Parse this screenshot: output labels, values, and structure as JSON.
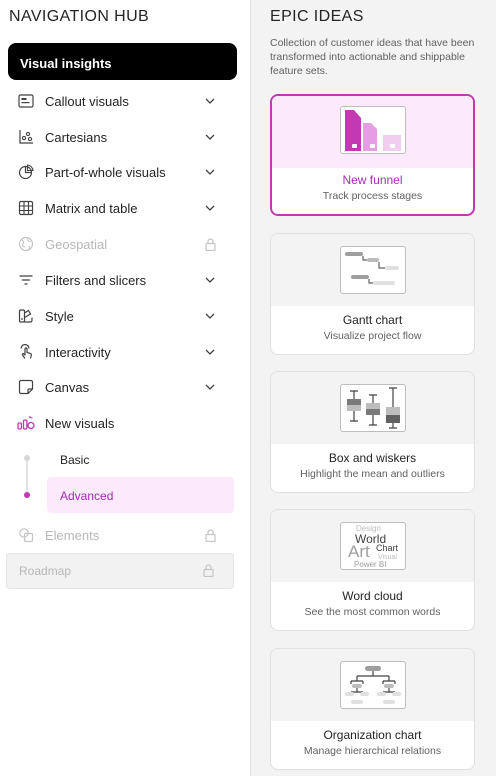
{
  "nav": {
    "title": "NAVIGATION HUB",
    "active_item": "Visual insights",
    "items": [
      {
        "label": "Callout visuals",
        "icon": "callout-icon"
      },
      {
        "label": "Cartesians",
        "icon": "cartesian-icon"
      },
      {
        "label": "Part-of-whole visuals",
        "icon": "pie-icon"
      },
      {
        "label": "Matrix and table",
        "icon": "table-icon"
      },
      {
        "label": "Geospatial",
        "icon": "globe-icon",
        "disabled": true
      },
      {
        "label": "Filters and slicers",
        "icon": "filter-icon"
      },
      {
        "label": "Style",
        "icon": "style-icon"
      },
      {
        "label": "Interactivity",
        "icon": "interactivity-icon"
      },
      {
        "label": "Canvas",
        "icon": "canvas-icon"
      },
      {
        "label": "New visuals",
        "icon": "new-visuals-icon",
        "expanded": true
      }
    ],
    "sub_items": [
      {
        "label": "Basic"
      },
      {
        "label": "Advanced",
        "selected": true
      }
    ],
    "elements": {
      "label": "Elements",
      "disabled": true
    },
    "roadmap": {
      "label": "Roadmap",
      "disabled": true
    }
  },
  "panel": {
    "title": "EPIC IDEAS",
    "description": "Collection of customer ideas that have been transformed into actionable and shippable feature sets.",
    "cards": [
      {
        "title": "New funnel",
        "subtitle": "Track process stages",
        "selected": true
      },
      {
        "title": "Gantt chart",
        "subtitle": "Visualize project flow"
      },
      {
        "title": "Box and wiskers",
        "subtitle": "Highlight the mean and outliers"
      },
      {
        "title": "Word cloud",
        "subtitle": "See the most common words",
        "words": [
          "Design",
          "World",
          "Chart",
          "Art",
          "Visual",
          "Power BI"
        ]
      },
      {
        "title": "Organization chart",
        "subtitle": "Manage hierarchical relations"
      }
    ]
  },
  "colors": {
    "accent": "#c239b3",
    "accent_text": "#a62bb6",
    "selected_bg": "#fbeafc",
    "active_nav_bg": "#000000"
  }
}
